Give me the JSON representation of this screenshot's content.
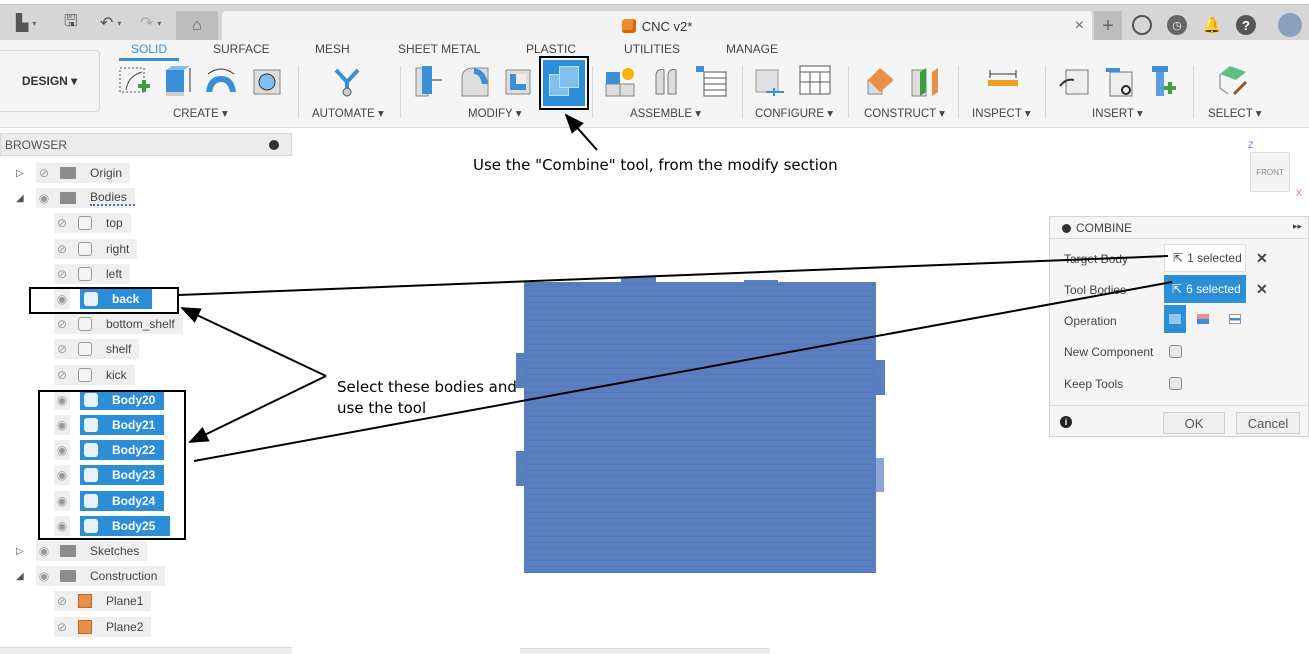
{
  "titlebar": {
    "document_title": "CNC v2*",
    "close_tab_glyph": "×",
    "new_tab_glyph": "+",
    "icons": [
      "file-menu-icon",
      "save-icon",
      "undo-icon",
      "redo-icon",
      "home-icon",
      "extensions-icon",
      "job-status-icon",
      "notifications-icon",
      "help-icon",
      "user-avatar-icon"
    ]
  },
  "ribbon": {
    "workspace_button": "DESIGN ▾",
    "tabs": [
      {
        "label": "SOLID",
        "active": true
      },
      {
        "label": "SURFACE",
        "active": false
      },
      {
        "label": "MESH",
        "active": false
      },
      {
        "label": "SHEET METAL",
        "active": false
      },
      {
        "label": "PLASTIC",
        "active": false
      },
      {
        "label": "UTILITIES",
        "active": false
      },
      {
        "label": "MANAGE",
        "active": false
      }
    ],
    "groups": [
      {
        "label": "CREATE ▾"
      },
      {
        "label": "AUTOMATE ▾"
      },
      {
        "label": "MODIFY ▾"
      },
      {
        "label": "ASSEMBLE ▾"
      },
      {
        "label": "CONFIGURE ▾"
      },
      {
        "label": "CONSTRUCT ▾"
      },
      {
        "label": "INSPECT ▾"
      },
      {
        "label": "INSERT ▾"
      },
      {
        "label": "SELECT ▾"
      }
    ],
    "highlighted_tool": "Combine"
  },
  "browser": {
    "title": "BROWSER",
    "items": [
      {
        "label": "Origin",
        "type": "folder",
        "expanded": false,
        "visible": false,
        "level": 0
      },
      {
        "label": "Bodies",
        "type": "folder",
        "expanded": true,
        "visible": true,
        "level": 0
      },
      {
        "label": "top",
        "type": "body",
        "visible": false,
        "selected": false,
        "level": 1
      },
      {
        "label": "right",
        "type": "body",
        "visible": false,
        "selected": false,
        "level": 1
      },
      {
        "label": "left",
        "type": "body",
        "visible": false,
        "selected": false,
        "level": 1
      },
      {
        "label": "back",
        "type": "body",
        "visible": true,
        "selected": true,
        "level": 1
      },
      {
        "label": "bottom_shelf",
        "type": "body",
        "visible": false,
        "selected": false,
        "level": 1
      },
      {
        "label": "shelf",
        "type": "body",
        "visible": false,
        "selected": false,
        "level": 1
      },
      {
        "label": "kick",
        "type": "body",
        "visible": false,
        "selected": false,
        "level": 1
      },
      {
        "label": "Body20",
        "type": "body",
        "visible": true,
        "selected": true,
        "level": 1
      },
      {
        "label": "Body21",
        "type": "body",
        "visible": true,
        "selected": true,
        "level": 1
      },
      {
        "label": "Body22",
        "type": "body",
        "visible": true,
        "selected": true,
        "level": 1
      },
      {
        "label": "Body23",
        "type": "body",
        "visible": true,
        "selected": true,
        "level": 1
      },
      {
        "label": "Body24",
        "type": "body",
        "visible": true,
        "selected": true,
        "level": 1
      },
      {
        "label": "Body25",
        "type": "body",
        "visible": true,
        "selected": true,
        "level": 1
      },
      {
        "label": "Sketches",
        "type": "folder",
        "expanded": false,
        "visible": true,
        "level": 0
      },
      {
        "label": "Construction",
        "type": "folder",
        "expanded": true,
        "visible": true,
        "level": 0
      },
      {
        "label": "Plane1",
        "type": "plane",
        "visible": false,
        "selected": false,
        "level": 1
      },
      {
        "label": "Plane2",
        "type": "plane",
        "visible": false,
        "selected": false,
        "level": 1
      }
    ]
  },
  "viewcube": {
    "face": "FRONT",
    "axis_z": "Z",
    "axis_x": "X"
  },
  "combine_panel": {
    "title": "COMBINE",
    "target_body_label": "Target Body",
    "target_body_value": "1 selected",
    "tool_bodies_label": "Tool Bodies",
    "tool_bodies_value": "6 selected",
    "operation_label": "Operation",
    "operation_options": [
      "join",
      "cut",
      "intersect"
    ],
    "operation_selected": "join",
    "new_component_label": "New Component",
    "new_component_checked": false,
    "keep_tools_label": "Keep Tools",
    "keep_tools_checked": false,
    "ok_label": "OK",
    "cancel_label": "Cancel",
    "clear_glyph": "✕"
  },
  "annotations": {
    "combine_hint": "Use the \"Combine\" tool, from the modify section",
    "select_hint_line1": "Select these bodies and",
    "select_hint_line2": "use the tool"
  },
  "colors": {
    "accent": "#2b8ed6",
    "model": "#5a7fbf",
    "tab_active": "#3b8fd0"
  }
}
